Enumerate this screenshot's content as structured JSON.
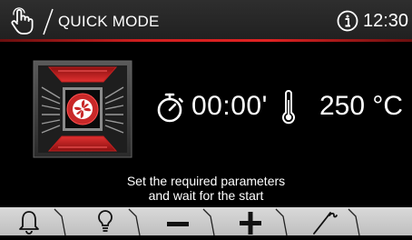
{
  "header": {
    "title": "QUICK MODE",
    "time": "12:30",
    "icons": {
      "mode": "hand-touch-icon",
      "info": "info-icon"
    }
  },
  "main": {
    "fan_icon": "convection-fan-icon",
    "timer_icon": "stopwatch-icon",
    "timer_value": "00:00'",
    "thermometer_icon": "thermometer-icon",
    "temperature_value": "250 °C"
  },
  "status": {
    "line1": "Set the required parameters",
    "line2": "and wait for the start"
  },
  "toolbar": {
    "items": [
      "bell-icon",
      "lightbulb-icon",
      "minus-icon",
      "plus-icon",
      "probe-icon"
    ]
  },
  "colors": {
    "accent": "#e02222",
    "header_bg": "#262626",
    "toolbar_bg": "#cfcfcf"
  }
}
